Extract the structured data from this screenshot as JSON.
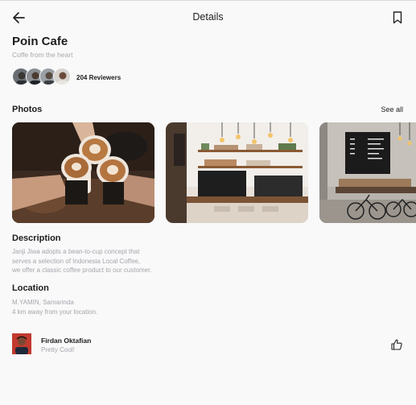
{
  "header": {
    "title": "Details",
    "back_icon": "arrow-left-icon",
    "bookmark_icon": "bookmark-icon"
  },
  "cafe": {
    "name": "Poin Cafe",
    "tagline": "Coffe from the heart"
  },
  "reviewers": {
    "count_label": "204 Reviewers",
    "avatar_count": 4
  },
  "photos": {
    "title": "Photos",
    "see_all": "See all",
    "items": [
      {
        "alt": "coffee-cheers-photo"
      },
      {
        "alt": "cafe-bar-photo"
      },
      {
        "alt": "cafe-interior-photo"
      }
    ]
  },
  "description": {
    "title": "Description",
    "lines": [
      "Janji Jiwa adopts a bean-to-cup concept that",
      "serves a selection of Indonesia Local Coffee,",
      "we offer a classic coffee product to our customer."
    ]
  },
  "location": {
    "title": "Location",
    "lines": [
      "M.YAMIN, Samarinda",
      "4 km away from your location."
    ]
  },
  "review": {
    "name": "Firdan Oktafian",
    "text": "Pretty Cool!",
    "like_icon": "thumbs-up-icon"
  }
}
